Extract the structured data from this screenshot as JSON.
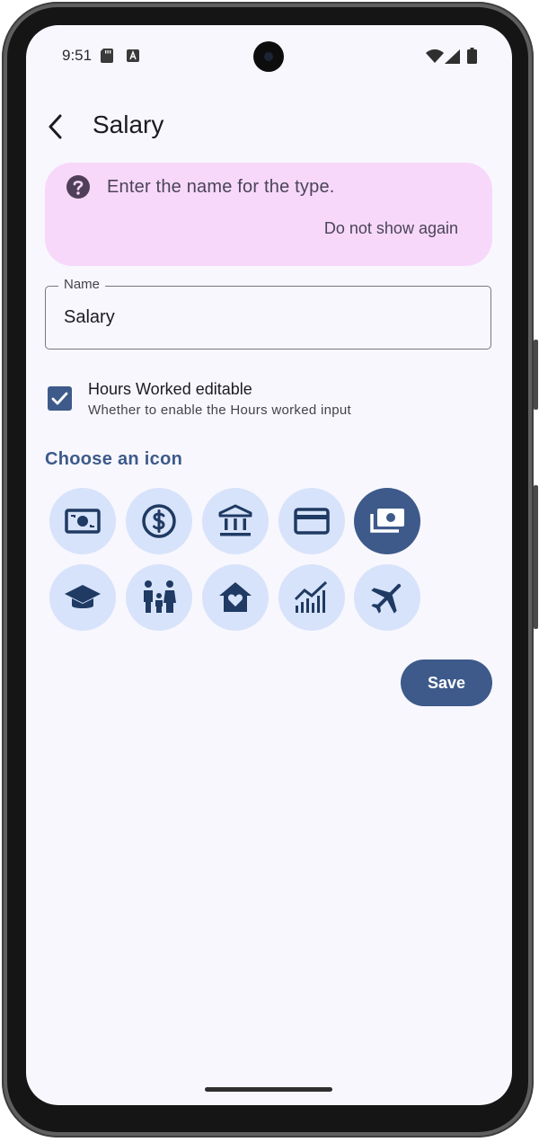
{
  "status_bar": {
    "time": "9:51"
  },
  "header": {
    "title": "Salary",
    "back_icon": "arrow-back-icon"
  },
  "hint": {
    "text": "Enter the name for the type.",
    "dismiss_label": "Do not show again",
    "icon": "help-circle-icon"
  },
  "name_field": {
    "label": "Name",
    "value": "Salary"
  },
  "hours_option": {
    "checked": true,
    "title": "Hours Worked editable",
    "subtitle": "Whether to enable the Hours worked input"
  },
  "icon_picker": {
    "title": "Choose an icon",
    "selected_index": 4,
    "icons": [
      "banknote-icon",
      "dollar-circle-icon",
      "bank-icon",
      "credit-card-icon",
      "payments-icon",
      "graduation-cap-icon",
      "family-icon",
      "home-heart-icon",
      "chart-growth-icon",
      "airplane-icon"
    ]
  },
  "actions": {
    "save_label": "Save"
  },
  "colors": {
    "primary": "#3d5a8a",
    "icon_bg": "#d7e3fa",
    "hint_bg": "#f7d8fb",
    "screen_bg": "#f8f7fe"
  }
}
